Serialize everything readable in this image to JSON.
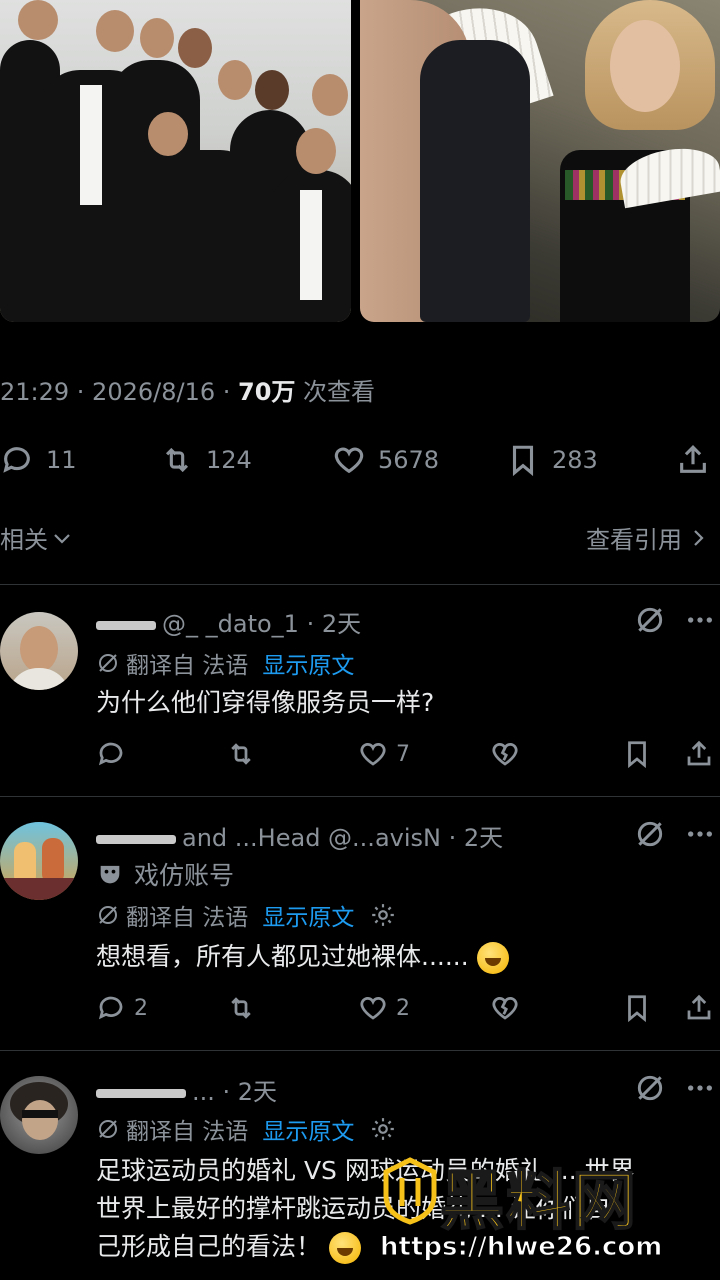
{
  "post_meta": {
    "time": "21:29 · 2026/8/16 · ",
    "views_count": "70万",
    "views_label": " 次查看"
  },
  "actions": {
    "replies": "11",
    "reposts": "124",
    "likes": "5678",
    "bookmarks": "283"
  },
  "related_label": "相关",
  "view_quotes_label": "查看引用",
  "comments": [
    {
      "username": "@_ _dato_1 · 2天",
      "translation": "翻译自 法语",
      "show_original": "显示原文",
      "text": "为什么他们穿得像服务员一样?",
      "replies": "",
      "reposts": "",
      "likes": "7"
    },
    {
      "username": "and ...Head @...avisN · 2天",
      "parody_label": "戏仿账号",
      "translation": "翻译自 法语",
      "show_original": "显示原文",
      "text": "想想看，所有人都见过她裸体......",
      "replies": "2",
      "reposts": "",
      "likes": "2"
    },
    {
      "username": "... · 2天",
      "translation": "翻译自 法语",
      "show_original": "显示原文",
      "text_lines": [
        "足球运动员的婚礼 VS 网球运动员的婚礼 ... 世界",
        "世界上最好的撑杆跳运动员的婚礼 ... 让你们自",
        "己形成自己的看法！"
      ]
    }
  ],
  "watermark": {
    "brand": "黑料网",
    "url": "https://hlwe26.com"
  }
}
